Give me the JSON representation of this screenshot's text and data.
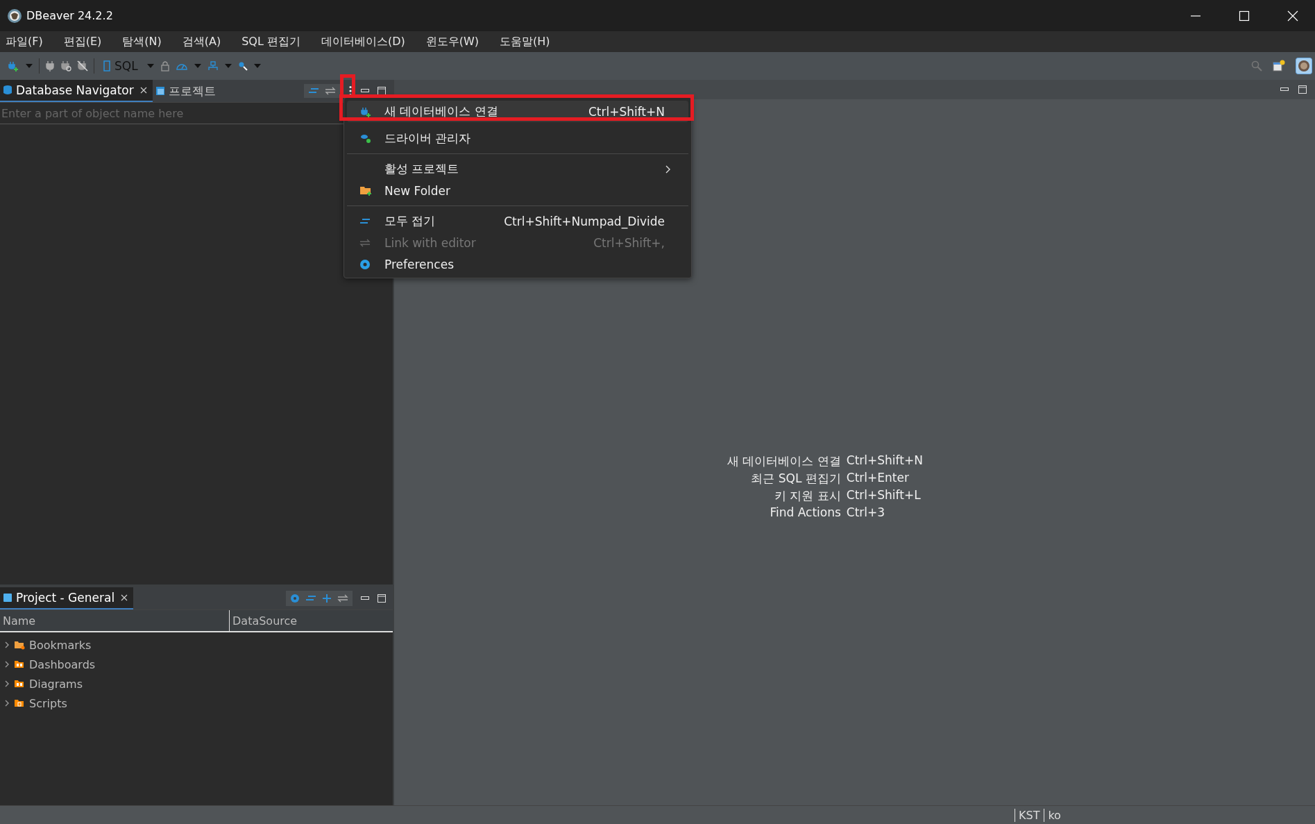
{
  "window": {
    "title": "DBeaver 24.2.2"
  },
  "menu_bar": [
    "파일(F)",
    "편집(E)",
    "탐색(N)",
    "검색(A)",
    "SQL 편집기",
    "데이터베이스(D)",
    "윈도우(W)",
    "도움말(H)"
  ],
  "toolbar": {
    "sql_label": "SQL"
  },
  "navigator_panel": {
    "tabs": [
      {
        "label": "Database Navigator",
        "selected": true
      },
      {
        "label": "프로젝트",
        "selected": false
      }
    ],
    "filter": {
      "placeholder": "Enter a part of object name here"
    }
  },
  "context_menu": {
    "items": [
      {
        "label": "새 데이터베이스 연결",
        "shortcut": "Ctrl+Shift+N",
        "highlighted": true,
        "disabled": false,
        "submenu": false,
        "separator_before": false
      },
      {
        "label": "드라이버 관리자",
        "highlighted": false,
        "disabled": false,
        "submenu": false,
        "separator_before": false
      },
      {
        "label": "활성 프로젝트",
        "highlighted": false,
        "disabled": false,
        "submenu": true,
        "separator_before": true
      },
      {
        "label": "New Folder",
        "highlighted": false,
        "disabled": false,
        "submenu": false,
        "separator_before": false
      },
      {
        "label": "모두 접기",
        "shortcut": "Ctrl+Shift+Numpad_Divide",
        "highlighted": false,
        "disabled": false,
        "submenu": false,
        "separator_before": true
      },
      {
        "label": "Link with editor",
        "shortcut": "Ctrl+Shift+,",
        "highlighted": false,
        "disabled": true,
        "submenu": false,
        "separator_before": false
      },
      {
        "label": "Preferences",
        "highlighted": false,
        "disabled": false,
        "submenu": false,
        "separator_before": false
      }
    ]
  },
  "project_panel": {
    "tab": {
      "label": "Project - General"
    },
    "columns": [
      "Name",
      "DataSource"
    ],
    "rows": [
      {
        "name": "Bookmarks",
        "expanded": false
      },
      {
        "name": "Dashboards",
        "expanded": false
      },
      {
        "name": "Diagrams",
        "expanded": false
      },
      {
        "name": "Scripts",
        "expanded": false
      }
    ]
  },
  "editor_hints": [
    {
      "action": "새 데이터베이스 연결",
      "shortcut": "Ctrl+Shift+N"
    },
    {
      "action": "최근 SQL 편집기",
      "shortcut": "Ctrl+Enter"
    },
    {
      "action": "키 지원 표시",
      "shortcut": "Ctrl+Shift+L"
    },
    {
      "action": "Find Actions",
      "shortcut": "Ctrl+3"
    }
  ],
  "status_bar": [
    "KST",
    "ko"
  ]
}
